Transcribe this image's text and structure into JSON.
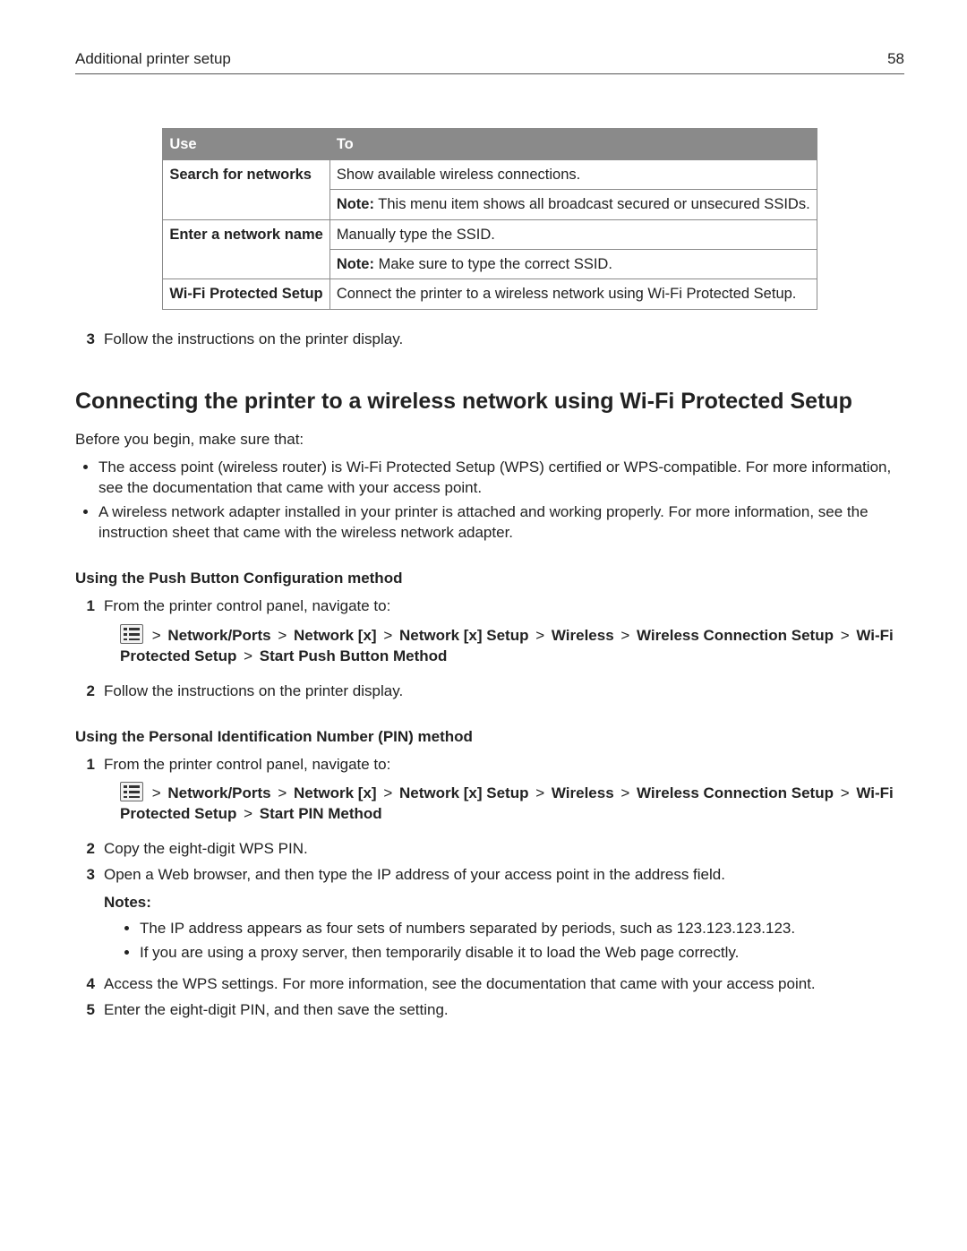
{
  "header": {
    "title": "Additional printer setup",
    "page": "58"
  },
  "table": {
    "head": {
      "c1": "Use",
      "c2": "To"
    },
    "rows": [
      {
        "k": "Search for networks",
        "v1": "Show available wireless connections.",
        "note_lead": "Note:",
        "note": " This menu item shows all broadcast secured or unsecured SSIDs."
      },
      {
        "k": "Enter a network name",
        "v1": "Manually type the SSID.",
        "note_lead": "Note:",
        "note": " Make sure to type the correct SSID."
      },
      {
        "k": "Wi‑Fi Protected Setup",
        "v1": "Connect the printer to a wireless network using Wi‑Fi Protected Setup."
      }
    ]
  },
  "after_table_step": {
    "num": "3",
    "text": "Follow the instructions on the printer display."
  },
  "section_title": "Connecting the printer to a wireless network using Wi‑Fi Protected Setup",
  "intro": "Before you begin, make sure that:",
  "intro_bullets": [
    "The access point (wireless router) is Wi‑Fi Protected Setup (WPS) certified or WPS‑compatible. For more information, see the documentation that came with your access point.",
    "A wireless network adapter installed in your printer is attached and working properly. For more information, see the instruction sheet that came with the wireless network adapter."
  ],
  "push": {
    "heading": "Using the Push Button Configuration method",
    "steps": {
      "s1_num": "1",
      "s1_text": "From the printer control panel, navigate to:",
      "s2_num": "2",
      "s2_text": "Follow the instructions on the printer display."
    },
    "path": {
      "sep": " > ",
      "p1": "Network/Ports",
      "p2": "Network [x]",
      "p3": "Network [x] Setup",
      "p4": "Wireless",
      "p5": "Wireless Connection Setup",
      "p6": "Wi‑Fi Protected Setup",
      "p7": "Start Push Button Method"
    }
  },
  "pin": {
    "heading": "Using the Personal Identification Number (PIN) method",
    "steps": {
      "s1_num": "1",
      "s1_text": "From the printer control panel, navigate to:",
      "s2_num": "2",
      "s2_text": "Copy the eight‑digit WPS PIN.",
      "s3_num": "3",
      "s3_text": "Open a Web browser, and then type the IP address of your access point in the address field.",
      "s4_num": "4",
      "s4_text": "Access the WPS settings. For more information, see the documentation that came with your access point.",
      "s5_num": "5",
      "s5_text": "Enter the eight‑digit PIN, and then save the setting."
    },
    "path": {
      "sep": " > ",
      "p1": "Network/Ports",
      "p2": "Network [x]",
      "p3": "Network [x] Setup",
      "p4": "Wireless",
      "p5": "Wireless Connection Setup",
      "p6": "Wi‑Fi Protected Setup",
      "p7": "Start PIN Method"
    },
    "notes_lead": "Notes:",
    "notes": [
      "The IP address appears as four sets of numbers separated by periods, such as 123.123.123.123.",
      "If you are using a proxy server, then temporarily disable it to load the Web page correctly."
    ]
  }
}
